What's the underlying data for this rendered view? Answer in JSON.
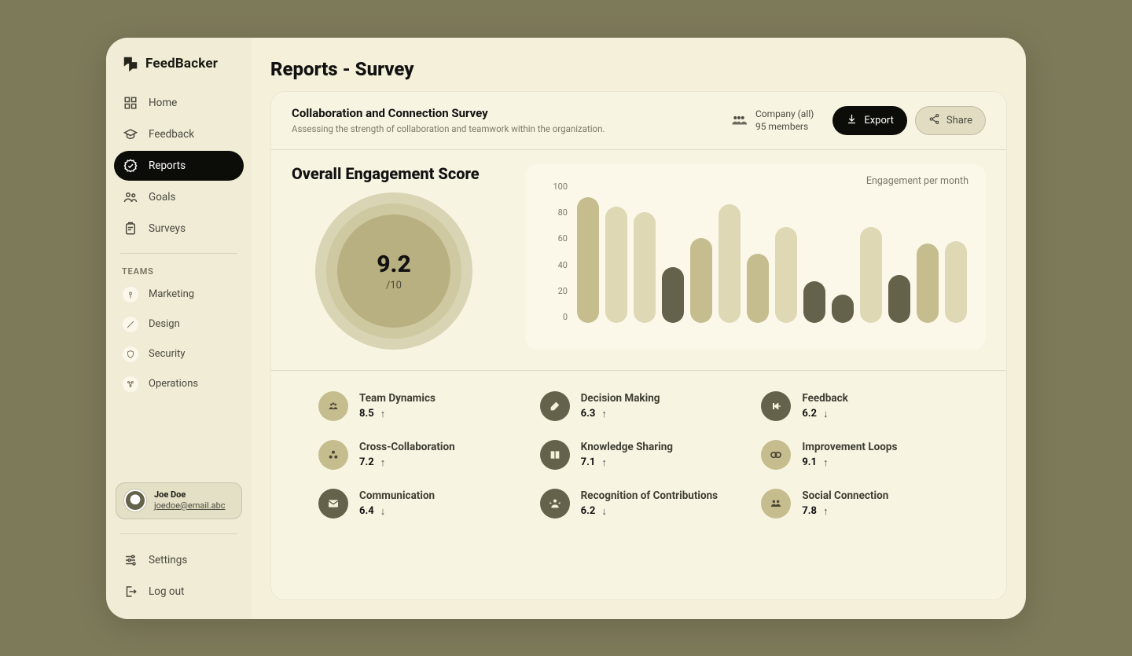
{
  "brand": "FeedBacker",
  "nav": [
    {
      "id": "home",
      "label": "Home"
    },
    {
      "id": "feedback",
      "label": "Feedback"
    },
    {
      "id": "reports",
      "label": "Reports",
      "active": true
    },
    {
      "id": "goals",
      "label": "Goals"
    },
    {
      "id": "surveys",
      "label": "Surveys"
    }
  ],
  "teams_label": "TEAMS",
  "teams": [
    {
      "id": "marketing",
      "label": "Marketing"
    },
    {
      "id": "design",
      "label": "Design"
    },
    {
      "id": "security",
      "label": "Security"
    },
    {
      "id": "operations",
      "label": "Operations"
    }
  ],
  "profile": {
    "name": "Joe Doe",
    "email": "joedoe@email.abc"
  },
  "bottom": {
    "settings": "Settings",
    "logout": "Log out"
  },
  "page_title": "Reports - Survey",
  "survey": {
    "title": "Collaboration and Connection Survey",
    "subtitle": "Assessing the strength of collaboration and teamwork within the organization.",
    "scope": "Company (all)",
    "members": "95 members"
  },
  "buttons": {
    "export": "Export",
    "share": "Share"
  },
  "score": {
    "title": "Overall Engagement Score",
    "value": "9.2",
    "of": "/10"
  },
  "chart_data": {
    "type": "bar",
    "title": "Engagement per month",
    "y_ticks": [
      "100",
      "80",
      "60",
      "40",
      "20",
      "0"
    ],
    "ylim": [
      0,
      100
    ],
    "values": [
      100,
      92,
      88,
      44,
      67,
      94,
      55,
      76,
      33,
      22,
      76,
      38,
      63,
      65
    ],
    "palette": [
      "#c6bd8f",
      "#ded8b5",
      "#ded8b5",
      "#64624a",
      "#c6bd8f",
      "#ded8b5",
      "#c6bd8f",
      "#ded8b5",
      "#64624a",
      "#64624a",
      "#ded8b5",
      "#64624a",
      "#c6bd8f",
      "#ded8b5"
    ]
  },
  "metrics": [
    {
      "name": "Team Dynamics",
      "value": "8.5",
      "trend": "up",
      "tone": "light"
    },
    {
      "name": "Decision Making",
      "value": "6.3",
      "trend": "up",
      "tone": "dark"
    },
    {
      "name": "Feedback",
      "value": "6.2",
      "trend": "down",
      "tone": "dark"
    },
    {
      "name": "Cross-Collaboration",
      "value": "7.2",
      "trend": "up",
      "tone": "light"
    },
    {
      "name": "Knowledge Sharing",
      "value": "7.1",
      "trend": "up",
      "tone": "dark"
    },
    {
      "name": "Improvement Loops",
      "value": "9.1",
      "trend": "up",
      "tone": "light"
    },
    {
      "name": "Communication",
      "value": "6.4",
      "trend": "down",
      "tone": "dark"
    },
    {
      "name": "Recognition of Contributions",
      "value": "6.2",
      "trend": "down",
      "tone": "dark"
    },
    {
      "name": "Social Connection",
      "value": "7.8",
      "trend": "up",
      "tone": "light"
    }
  ]
}
